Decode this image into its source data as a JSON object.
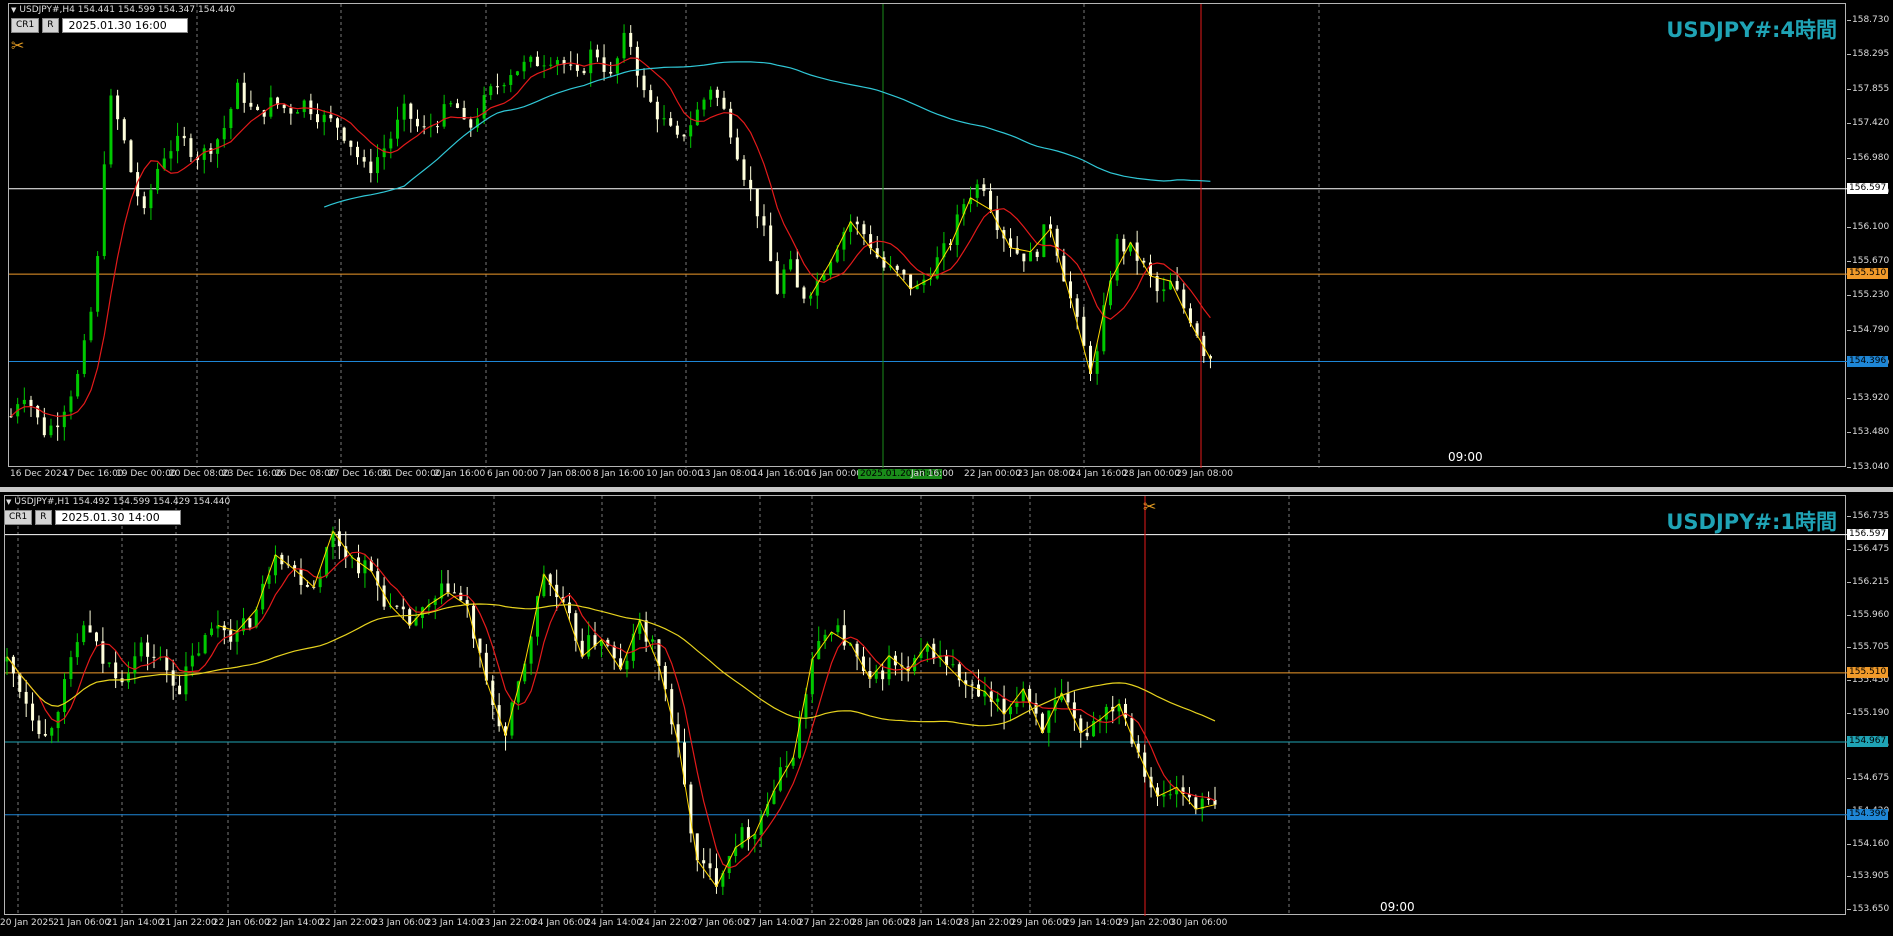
{
  "colors": {
    "background": "#000000",
    "candle_up": "#00c800",
    "candle_down": "#ffffdc",
    "ma_red": "#e31a1a",
    "ma_cyan": "#30c7d6",
    "ma_yellow": "#e6d21e",
    "zigzag": "#ffd700",
    "line_white": "#ffffff",
    "line_orange": "#f09a2a",
    "line_blue": "#1e86d6",
    "line_teal": "#1fa3b5",
    "vline_red": "#e31a1a",
    "vline_green": "#1a8c1a"
  },
  "chart_h4": {
    "info": "USDJPY#,H4  154.441 154.599 154.347 154.440",
    "btn_cr": "CR1",
    "btn_r": "R",
    "datetime": "2025.01.30 16:00",
    "title": "USDJPY#:4時間",
    "tool_icon": "crosshair-tool-icon",
    "price_ticks": [
      "158.730",
      "158.295",
      "157.855",
      "157.420",
      "156.980",
      "156.540",
      "156.100",
      "155.670",
      "155.230",
      "154.790",
      "154.360",
      "153.920",
      "153.480",
      "153.040"
    ],
    "badges": {
      "white": "156.597",
      "orange": "155.510",
      "blue": "154.396"
    },
    "time_ticks": [
      "16 Dec 2024",
      "17 Dec 16:00",
      "19 Dec 00:00",
      "20 Dec 08:00",
      "23 Dec 16:00",
      "26 Dec 08:00",
      "27 Dec 16:00",
      "31 Dec 00:00",
      "2 Jan 16:00",
      "6 Jan 00:00",
      "7 Jan 08:00",
      "8 Jan 16:00",
      "10 Jan 00:00",
      "13 Jan 08:00",
      "14 Jan 16:00",
      "16 Jan 00:00",
      "2025.01.20 08:00",
      "Jan 16:00",
      "22 Jan 00:00",
      "23 Jan 08:00",
      "24 Jan 16:00",
      "28 Jan 00:00",
      "29 Jan 08:00"
    ],
    "marker": "09:00"
  },
  "chart_h1": {
    "info": "USDJPY#,H1  154.492 154.599 154.429 154.440",
    "btn_cr": "CR1",
    "btn_r": "R",
    "datetime": "2025.01.30 14:00",
    "title": "USDJPY#:1時間",
    "tool_icon": "crosshair-tool-icon",
    "price_ticks": [
      "156.735",
      "156.475",
      "156.215",
      "155.960",
      "155.705",
      "155.450",
      "155.190",
      "154.935",
      "154.675",
      "154.420",
      "154.160",
      "153.905",
      "153.650"
    ],
    "badges": {
      "white": "156.597",
      "orange": "155.510",
      "teal": "154.967",
      "blue": "154.396"
    },
    "time_ticks": [
      "20 Jan 2025",
      "21 Jan 06:00",
      "21 Jan 14:00",
      "21 Jan 22:00",
      "22 Jan 06:00",
      "22 Jan 14:00",
      "22 Jan 22:00",
      "23 Jan 06:00",
      "23 Jan 14:00",
      "23 Jan 22:00",
      "24 Jan 06:00",
      "24 Jan 14:00",
      "24 Jan 22:00",
      "27 Jan 06:00",
      "27 Jan 14:00",
      "27 Jan 22:00",
      "28 Jan 06:00",
      "28 Jan 14:00",
      "28 Jan 22:00",
      "29 Jan 06:00",
      "29 Jan 14:00",
      "29 Jan 22:00",
      "30 Jan 06:00"
    ],
    "marker": "09:00"
  },
  "chart_data": [
    {
      "type": "candlestick",
      "timeframe": "H4",
      "ylim": [
        153.04,
        158.95
      ],
      "horizontal_lines": [
        156.597,
        155.51,
        154.396
      ],
      "close_path": [
        [
          0,
          153.7
        ],
        [
          10,
          154.05
        ],
        [
          20,
          153.8
        ],
        [
          28,
          153.5
        ],
        [
          40,
          153.6
        ],
        [
          50,
          153.9
        ],
        [
          60,
          154.2
        ],
        [
          70,
          154.8
        ],
        [
          80,
          155.9
        ],
        [
          84,
          157.0
        ],
        [
          90,
          157.7
        ],
        [
          100,
          157.3
        ],
        [
          110,
          156.7
        ],
        [
          120,
          156.25
        ],
        [
          130,
          156.8
        ],
        [
          140,
          157.1
        ],
        [
          155,
          157.2
        ],
        [
          170,
          157.0
        ],
        [
          190,
          157.3
        ],
        [
          205,
          157.9
        ],
        [
          220,
          157.5
        ],
        [
          235,
          157.7
        ],
        [
          250,
          157.6
        ],
        [
          265,
          157.7
        ],
        [
          280,
          157.5
        ],
        [
          295,
          157.4
        ],
        [
          305,
          157.2
        ],
        [
          320,
          156.8
        ],
        [
          340,
          157.2
        ],
        [
          355,
          157.6
        ],
        [
          370,
          157.3
        ],
        [
          385,
          157.5
        ],
        [
          400,
          157.7
        ],
        [
          410,
          157.3
        ],
        [
          430,
          157.8
        ],
        [
          450,
          158.1
        ],
        [
          470,
          158.2
        ],
        [
          490,
          158.3
        ],
        [
          510,
          158.0
        ],
        [
          525,
          158.4
        ],
        [
          540,
          158.0
        ],
        [
          555,
          158.6
        ],
        [
          570,
          157.8
        ],
        [
          585,
          157.5
        ],
        [
          600,
          157.2
        ],
        [
          615,
          157.5
        ],
        [
          630,
          157.9
        ],
        [
          645,
          157.5
        ],
        [
          660,
          156.8
        ],
        [
          675,
          156.2
        ],
        [
          690,
          155.3
        ],
        [
          700,
          155.7
        ],
        [
          710,
          155.2
        ],
        [
          725,
          155.4
        ],
        [
          740,
          155.8
        ],
        [
          755,
          156.2
        ],
        [
          770,
          156.0
        ],
        [
          785,
          155.6
        ],
        [
          800,
          155.5
        ],
        [
          815,
          155.3
        ],
        [
          830,
          155.6
        ],
        [
          845,
          155.9
        ],
        [
          860,
          156.5
        ],
        [
          875,
          156.7
        ],
        [
          890,
          156.1
        ],
        [
          905,
          155.8
        ],
        [
          920,
          155.7
        ],
        [
          935,
          156.2
        ],
        [
          950,
          155.4
        ],
        [
          965,
          154.6
        ],
        [
          975,
          154.2
        ],
        [
          985,
          155.1
        ],
        [
          995,
          155.9
        ],
        [
          1010,
          155.8
        ],
        [
          1020,
          155.6
        ],
        [
          1035,
          155.2
        ],
        [
          1045,
          155.4
        ],
        [
          1055,
          155.1
        ],
        [
          1065,
          154.9
        ],
        [
          1075,
          154.5
        ],
        [
          1085,
          154.44
        ]
      ]
    },
    {
      "type": "candlestick",
      "timeframe": "H1",
      "ylim": [
        153.6,
        156.9
      ],
      "horizontal_lines": [
        156.597,
        155.51,
        154.967,
        154.396
      ],
      "close_path": [
        [
          0,
          155.6
        ],
        [
          15,
          155.3
        ],
        [
          30,
          155.0
        ],
        [
          45,
          155.4
        ],
        [
          60,
          155.9
        ],
        [
          75,
          155.6
        ],
        [
          90,
          155.5
        ],
        [
          105,
          155.7
        ],
        [
          120,
          155.6
        ],
        [
          135,
          155.4
        ],
        [
          150,
          155.7
        ],
        [
          165,
          155.9
        ],
        [
          180,
          155.8
        ],
        [
          195,
          156.0
        ],
        [
          210,
          156.5
        ],
        [
          225,
          156.3
        ],
        [
          240,
          156.2
        ],
        [
          255,
          156.6
        ],
        [
          270,
          156.4
        ],
        [
          285,
          156.3
        ],
        [
          300,
          156.0
        ],
        [
          315,
          155.9
        ],
        [
          330,
          156.0
        ],
        [
          345,
          156.2
        ],
        [
          360,
          156.0
        ],
        [
          375,
          155.4
        ],
        [
          390,
          155.0
        ],
        [
          405,
          155.6
        ],
        [
          420,
          156.3
        ],
        [
          435,
          156.0
        ],
        [
          450,
          155.7
        ],
        [
          465,
          155.8
        ],
        [
          480,
          155.5
        ],
        [
          495,
          155.9
        ],
        [
          510,
          155.6
        ],
        [
          525,
          154.9
        ],
        [
          540,
          154.0
        ],
        [
          555,
          153.9
        ],
        [
          570,
          154.2
        ],
        [
          585,
          154.3
        ],
        [
          600,
          154.6
        ],
        [
          615,
          154.9
        ],
        [
          630,
          155.6
        ],
        [
          645,
          155.9
        ],
        [
          660,
          155.7
        ],
        [
          675,
          155.4
        ],
        [
          690,
          155.6
        ],
        [
          705,
          155.5
        ],
        [
          720,
          155.7
        ],
        [
          735,
          155.6
        ],
        [
          750,
          155.4
        ],
        [
          765,
          155.3
        ],
        [
          780,
          155.2
        ],
        [
          795,
          155.4
        ],
        [
          810,
          155.1
        ],
        [
          825,
          155.3
        ],
        [
          840,
          155.0
        ],
        [
          855,
          155.2
        ],
        [
          870,
          155.3
        ],
        [
          885,
          154.9
        ],
        [
          900,
          154.5
        ],
        [
          915,
          154.6
        ],
        [
          930,
          154.5
        ],
        [
          945,
          154.45
        ]
      ]
    }
  ]
}
